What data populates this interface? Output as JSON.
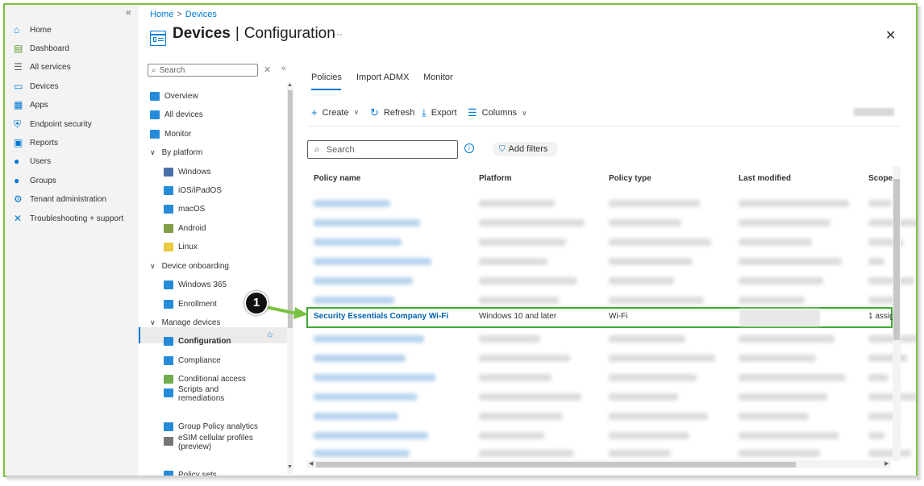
{
  "global_nav": {
    "items": [
      {
        "label": "Home",
        "icon": "home-icon",
        "color": "#0078d4"
      },
      {
        "label": "Dashboard",
        "icon": "dashboard-icon",
        "color": "#5c9e31"
      },
      {
        "label": "All services",
        "icon": "list-icon",
        "color": "#605e5c"
      },
      {
        "label": "Devices",
        "icon": "devices-icon",
        "color": "#0078d4"
      },
      {
        "label": "Apps",
        "icon": "apps-icon",
        "color": "#0078d4"
      },
      {
        "label": "Endpoint security",
        "icon": "shield-icon",
        "color": "#0078d4"
      },
      {
        "label": "Reports",
        "icon": "reports-icon",
        "color": "#0078d4"
      },
      {
        "label": "Users",
        "icon": "user-icon",
        "color": "#0078d4"
      },
      {
        "label": "Groups",
        "icon": "groups-icon",
        "color": "#0078d4"
      },
      {
        "label": "Tenant administration",
        "icon": "tenant-icon",
        "color": "#0078d4"
      },
      {
        "label": "Troubleshooting + support",
        "icon": "wrench-icon",
        "color": "#0078d4"
      }
    ]
  },
  "breadcrumb": {
    "home": "Home",
    "devices": "Devices"
  },
  "header": {
    "title_bold": "Devices",
    "title_sep": "|",
    "title_rest": "Configuration",
    "ellipsis": "···",
    "close": "✕"
  },
  "resource_menu": {
    "search_placeholder": "Search",
    "items": [
      {
        "label": "Overview",
        "level": 0
      },
      {
        "label": "All devices",
        "level": 0
      },
      {
        "label": "Monitor",
        "level": 0
      },
      {
        "label": "By platform",
        "level": 0,
        "group": true
      },
      {
        "label": "Windows",
        "level": 1
      },
      {
        "label": "iOS/iPadOS",
        "level": 1
      },
      {
        "label": "macOS",
        "level": 1
      },
      {
        "label": "Android",
        "level": 1
      },
      {
        "label": "Linux",
        "level": 1
      },
      {
        "label": "Device onboarding",
        "level": 0,
        "group": true
      },
      {
        "label": "Windows 365",
        "level": 1
      },
      {
        "label": "Enrollment",
        "level": 1
      },
      {
        "label": "Manage devices",
        "level": 0,
        "group": true
      },
      {
        "label": "Configuration",
        "level": 1,
        "selected": true
      },
      {
        "label": "Compliance",
        "level": 1
      },
      {
        "label": "Conditional access",
        "level": 1
      },
      {
        "label": "Scripts and",
        "label2": "remediations",
        "level": 1
      },
      {
        "label": "Group Policy analytics",
        "level": 1
      },
      {
        "label": "eSIM cellular profiles",
        "label2": "(preview)",
        "level": 1
      },
      {
        "label": "Policy sets",
        "level": 1
      }
    ]
  },
  "tabs": [
    "Policies",
    "Import ADMX",
    "Monitor"
  ],
  "toolbar": {
    "create": "Create",
    "refresh": "Refresh",
    "export": "Export",
    "columns": "Columns"
  },
  "filter": {
    "search_placeholder": "Search",
    "add_filters": "Add filters"
  },
  "table": {
    "columns": [
      "Policy name",
      "Platform",
      "Policy type",
      "Last modified",
      "Scope"
    ],
    "highlighted_row": {
      "policy_name": "Security Essentials Company Wi-Fi",
      "platform": "Windows 10 and later",
      "policy_type": "Wi-Fi",
      "scope": "1 assig"
    }
  },
  "callout": {
    "number": "1"
  },
  "colors": {
    "accent": "#0078d4",
    "highlight_border": "#3fa934",
    "frame_border": "#7cc242"
  }
}
